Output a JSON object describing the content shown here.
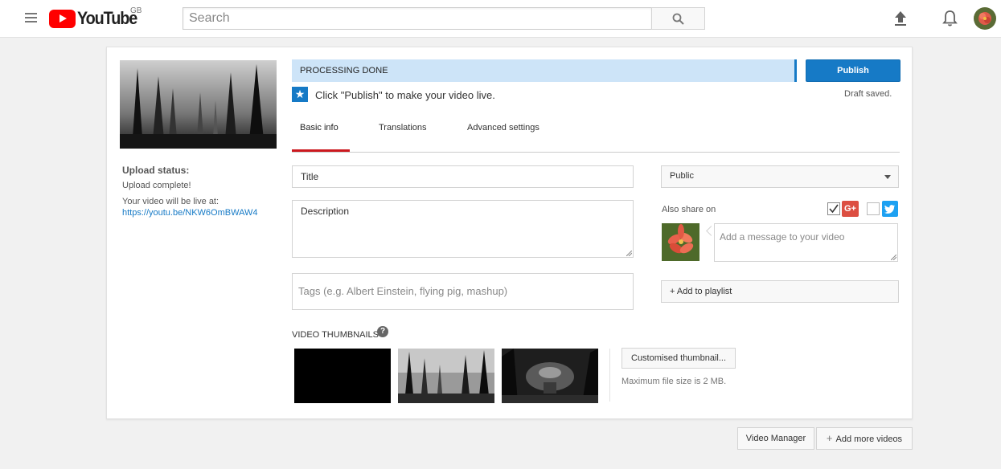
{
  "masthead": {
    "logo_text": "YouTube",
    "country_code": "GB",
    "search_placeholder": "Search"
  },
  "sidebar": {
    "upload_status_title": "Upload status:",
    "upload_complete": "Upload complete!",
    "live_at_label": "Your video will be live at:",
    "video_url": "https://youtu.be/NKW6OmBWAW4"
  },
  "status": {
    "processing_text": "PROCESSING DONE",
    "publish_label": "Publish",
    "draft_saved": "Draft saved.",
    "publish_hint": "Click \"Publish\" to make your video live."
  },
  "tabs": [
    {
      "label": "Basic info",
      "active": true
    },
    {
      "label": "Translations",
      "active": false
    },
    {
      "label": "Advanced settings",
      "active": false
    }
  ],
  "form": {
    "title_placeholder": "Title",
    "description_placeholder": "Description",
    "tags_placeholder": "Tags (e.g. Albert Einstein, flying pig, mashup)",
    "privacy_value": "Public",
    "also_share_label": "Also share on",
    "gplus_label": "G+",
    "gplus_checked": true,
    "twitter_checked": false,
    "share_message_placeholder": "Add a message to your video",
    "add_to_playlist": "+ Add to playlist"
  },
  "thumbnails": {
    "label": "VIDEO THUMBNAILS",
    "custom_button": "Customised thumbnail...",
    "max_size_note": "Maximum file size is 2 MB."
  },
  "footer": {
    "video_manager": "Video Manager",
    "add_more_videos": "Add more videos"
  },
  "colors": {
    "brand_red": "#ff0000",
    "accent_blue": "#167ac6",
    "processing_bg": "#cde4f8",
    "tab_underline": "#cc181e",
    "gplus_red": "#dc4e41",
    "twitter_blue": "#1da1f2"
  }
}
